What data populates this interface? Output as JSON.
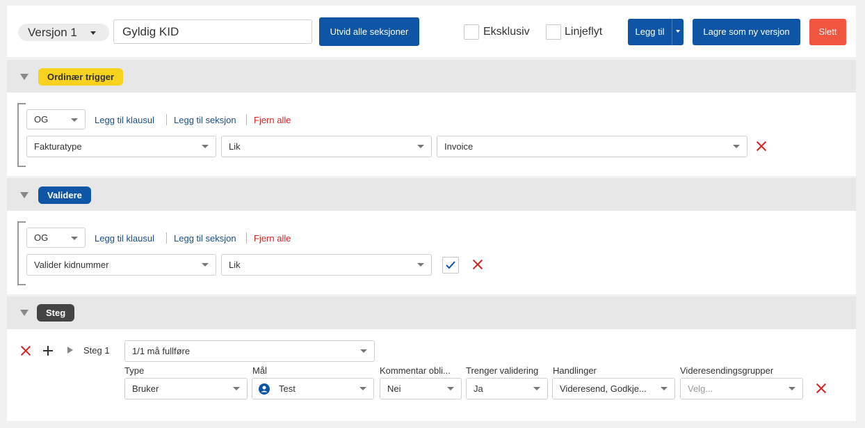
{
  "toolbar": {
    "version_label": "Versjon 1",
    "name_value": "Gyldig KID",
    "expand_label": "Utvid alle seksjoner",
    "exclusive_label": "Eksklusiv",
    "lineflow_label": "Linjeflyt",
    "add_label": "Legg til",
    "save_new_label": "Lagre som ny versjon",
    "delete_label": "Slett"
  },
  "sections": {
    "trigger": {
      "tag": "Ordinær trigger",
      "tag_color": "#f7d21e",
      "operator": "OG",
      "add_clause": "Legg til klausul",
      "add_section": "Legg til seksjon",
      "remove_all": "Fjern alle",
      "field": "Fakturatype",
      "comparison": "Lik",
      "value": "Invoice"
    },
    "validate": {
      "tag": "Validere",
      "tag_color": "#0e55a5",
      "operator": "OG",
      "add_clause": "Legg til klausul",
      "add_section": "Legg til seksjon",
      "remove_all": "Fjern alle",
      "field": "Valider kidnummer",
      "comparison": "Lik"
    },
    "steps": {
      "tag": "Steg",
      "tag_color": "#444444",
      "step_label": "Steg 1",
      "completion": "1/1 må fullføre",
      "columns": {
        "type": "Type",
        "target": "Mål",
        "comment": "Kommentar obli...",
        "needs_validation": "Trenger validering",
        "actions": "Handlinger",
        "forward_groups": "Videresendingsgrupper"
      },
      "values": {
        "type": "Bruker",
        "target": "Test",
        "comment": "Nei",
        "needs_validation": "Ja",
        "actions": "Videresend, Godkje...",
        "forward_groups_placeholder": "Velg..."
      }
    }
  },
  "colors": {
    "primary": "#0e55a5",
    "danger": "#f1543f",
    "remove_x": "#d62424"
  }
}
